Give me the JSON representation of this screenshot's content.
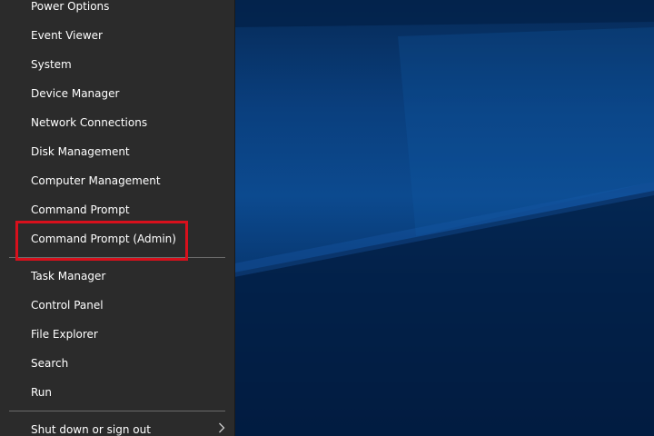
{
  "menu": {
    "items": [
      {
        "label": "Power Options"
      },
      {
        "label": "Event Viewer"
      },
      {
        "label": "System"
      },
      {
        "label": "Device Manager"
      },
      {
        "label": "Network Connections"
      },
      {
        "label": "Disk Management"
      },
      {
        "label": "Computer Management"
      },
      {
        "label": "Command Prompt"
      },
      {
        "label": "Command Prompt (Admin)"
      },
      {
        "label": "Task Manager"
      },
      {
        "label": "Control Panel"
      },
      {
        "label": "File Explorer"
      },
      {
        "label": "Search"
      },
      {
        "label": "Run"
      },
      {
        "label": "Shut down or sign out"
      }
    ],
    "submenu_icon": "chevron-right-icon"
  },
  "colors": {
    "menu_background": "#2b2b2b",
    "menu_text": "#ffffff",
    "highlight": "#d8101c",
    "desktop": "#0a3f7e"
  }
}
